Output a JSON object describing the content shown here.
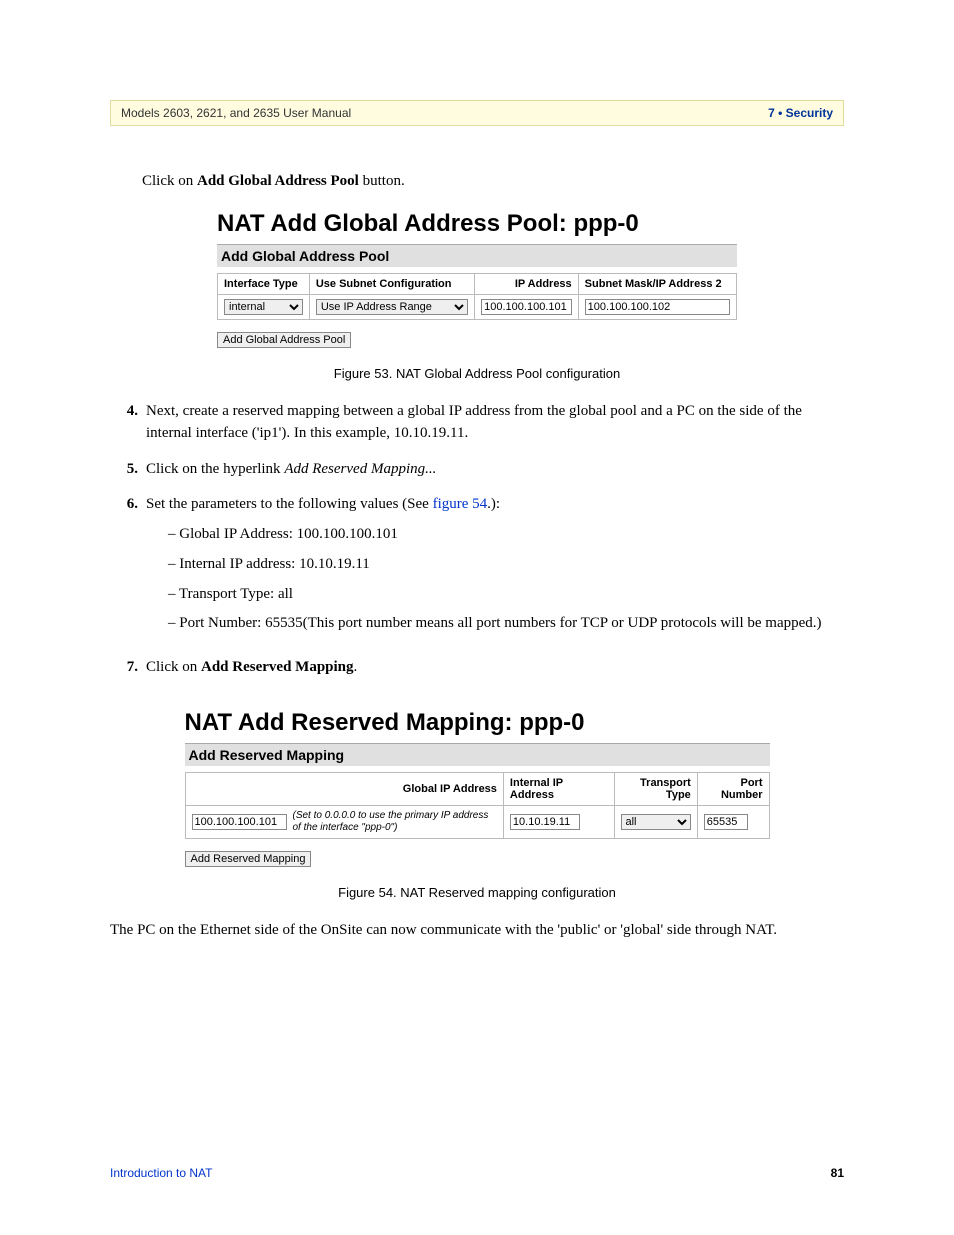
{
  "header": {
    "left": "Models 2603, 2621, and 2635 User Manual",
    "right": "7 • Security"
  },
  "intro": {
    "prefix": "Click on ",
    "button_name": "Add Global Address Pool",
    "suffix": " button."
  },
  "fig53": {
    "title": "NAT Add Global Address Pool: ppp-0",
    "section": "Add Global Address Pool",
    "cols": {
      "c1": "Interface Type",
      "c2": "Use Subnet Configuration",
      "c3": "IP Address",
      "c4": "Subnet Mask/IP Address 2"
    },
    "interface_type": "internal",
    "subnet_config": "Use IP Address Range",
    "ip_address": "100.100.100.101",
    "subnet_mask": "100.100.100.102",
    "button": "Add Global Address Pool",
    "caption": "Figure 53. NAT Global Address Pool configuration"
  },
  "steps": {
    "s4": "Next, create a reserved mapping between a global IP address from the global pool and a PC on the side of the internal interface ('ip1'). In this example, 10.10.19.11.",
    "s5_prefix": "Click on the hyperlink ",
    "s5_link": "Add Reserved Mapping...",
    "s6_prefix": "Set the parameters to the following values (See ",
    "s6_figlink": "figure 54",
    "s6_suffix": ".):",
    "s6_items": {
      "a": "Global IP Address: 100.100.100.101",
      "b": "Internal IP address: 10.10.19.11",
      "c": "Transport Type: all",
      "d": "Port Number: 65535(This port number means all port numbers for TCP or UDP protocols will be mapped.)"
    },
    "s7_prefix": "Click on ",
    "s7_bold": "Add Reserved Mapping",
    "s7_suffix": "."
  },
  "fig54": {
    "title": "NAT Add Reserved Mapping: ppp-0",
    "section": "Add Reserved Mapping",
    "cols": {
      "c1": "Global IP Address",
      "c2": "Internal IP Address",
      "c3": "Transport Type",
      "c4": "Port Number"
    },
    "global_ip": "100.100.100.101",
    "global_note": "(Set to 0.0.0.0 to use the primary IP address of the interface \"ppp-0\")",
    "internal_ip": "10.10.19.11",
    "transport": "all",
    "port": "65535",
    "button": "Add Reserved Mapping",
    "caption": "Figure 54. NAT Reserved mapping configuration"
  },
  "closing": "The PC on the Ethernet side of the OnSite can now communicate with the 'public' or 'global' side through NAT.",
  "footer": {
    "left": "Introduction to NAT",
    "page": "81"
  }
}
